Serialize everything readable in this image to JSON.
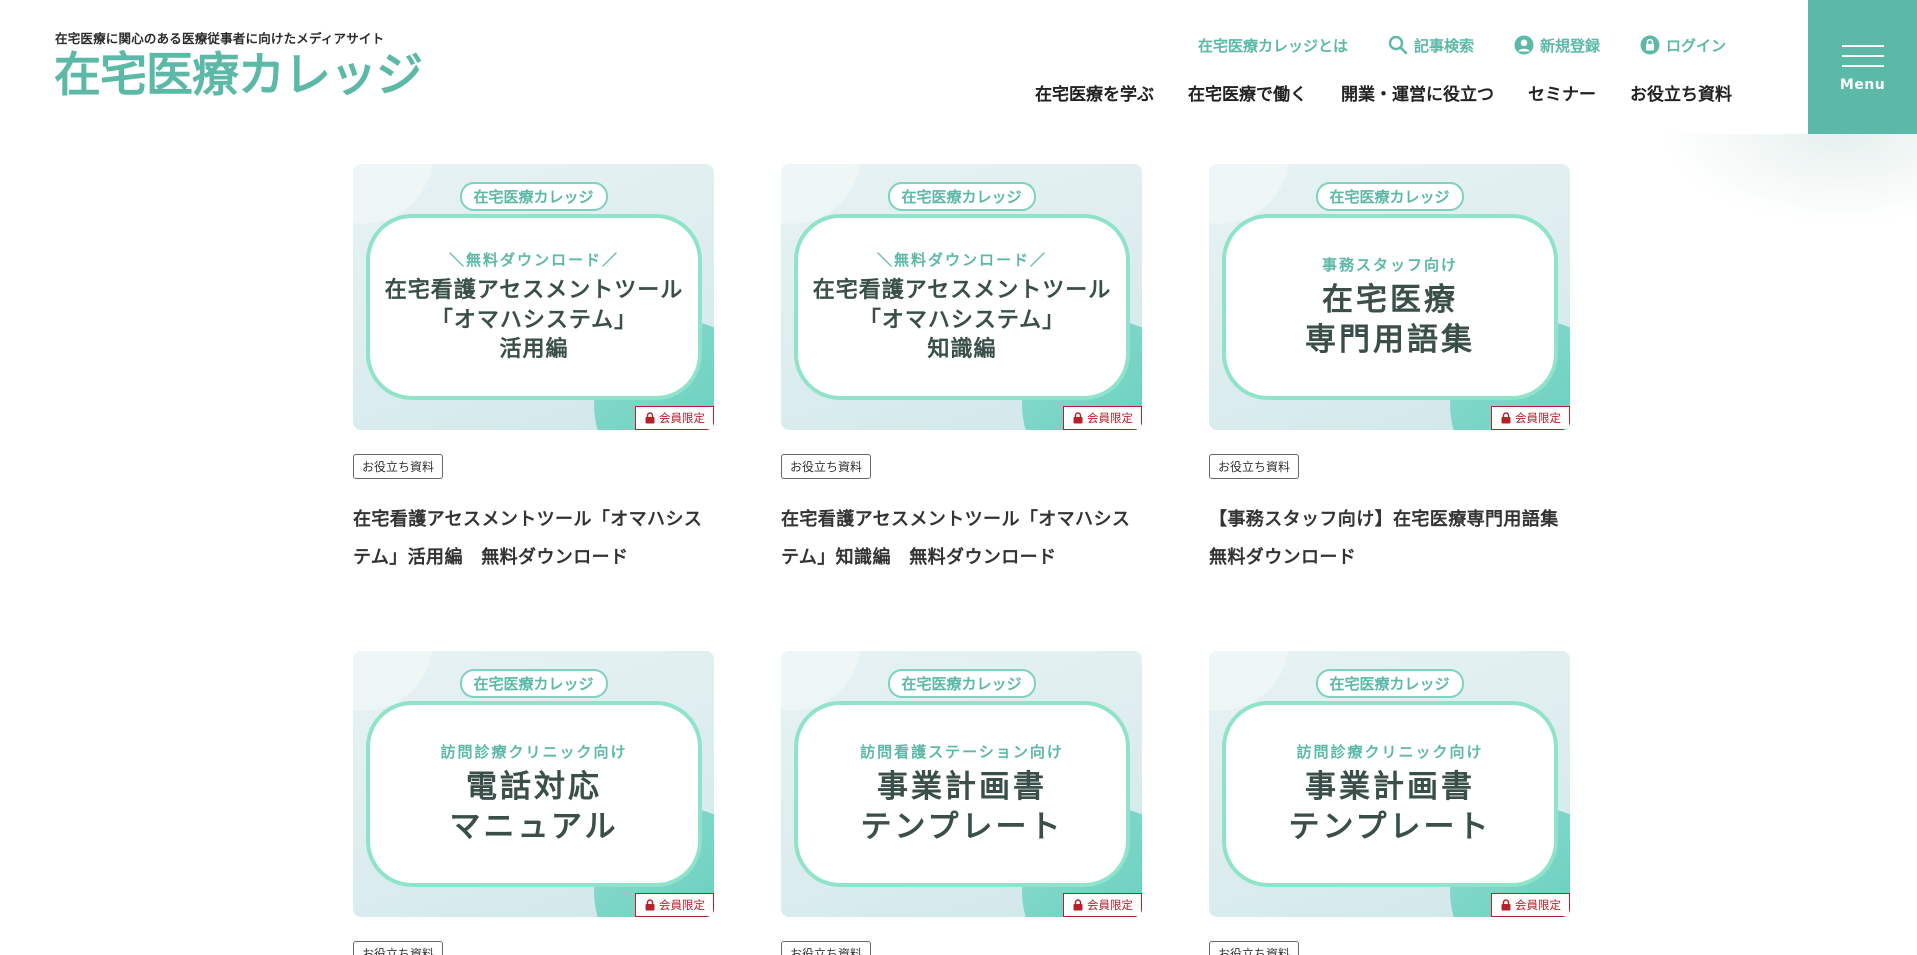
{
  "header": {
    "tagline": "在宅医療に関心のある医療従事者に向けたメディアサイト",
    "logo": "在宅医療カレッジ",
    "util_nav": [
      {
        "label": "在宅医療カレッジとは",
        "icon": null
      },
      {
        "label": "記事検索",
        "icon": "search-icon"
      },
      {
        "label": "新規登録",
        "icon": "user-icon"
      },
      {
        "label": "ログイン",
        "icon": "lock-icon"
      }
    ],
    "main_nav": [
      "在宅医療を学ぶ",
      "在宅医療で働く",
      "開業・運営に役立つ",
      "セミナー",
      "お役立ち資料"
    ],
    "menu_label": "Menu"
  },
  "colors": {
    "accent": "#5cb9a8",
    "lock_badge": "#b4232a"
  },
  "cards": [
    {
      "thumb_tag": "在宅医療カレッジ",
      "thumb_sub": "＼無料ダウンロード／",
      "thumb_main": "在宅看護アセスメントツール\n「オマハシステム」\n活用編",
      "badge": "会員限定",
      "category": "お役立ち資料",
      "title": "在宅看護アセスメントツール「オマハシステム」活用編　無料ダウンロード"
    },
    {
      "thumb_tag": "在宅医療カレッジ",
      "thumb_sub": "＼無料ダウンロード／",
      "thumb_main": "在宅看護アセスメントツール\n「オマハシステム」\n知識編",
      "badge": "会員限定",
      "category": "お役立ち資料",
      "title": "在宅看護アセスメントツール「オマハシステム」知識編　無料ダウンロード"
    },
    {
      "thumb_tag": "在宅医療カレッジ",
      "thumb_sub": "事務スタッフ向け",
      "thumb_main": "在宅医療\n専門用語集",
      "badge": "会員限定",
      "category": "お役立ち資料",
      "title": "【事務スタッフ向け】在宅医療専門用語集　無料ダウンロード"
    },
    {
      "thumb_tag": "在宅医療カレッジ",
      "thumb_sub": "訪問診療クリニック向け",
      "thumb_main": "電話対応\nマニュアル",
      "badge": "会員限定",
      "category": "お役立ち資料",
      "title": ""
    },
    {
      "thumb_tag": "在宅医療カレッジ",
      "thumb_sub": "訪問看護ステーション向け",
      "thumb_main": "事業計画書\nテンプレート",
      "badge": "会員限定",
      "category": "お役立ち資料",
      "title": ""
    },
    {
      "thumb_tag": "在宅医療カレッジ",
      "thumb_sub": "訪問診療クリニック向け",
      "thumb_main": "事業計画書\nテンプレート",
      "badge": "会員限定",
      "category": "お役立ち資料",
      "title": ""
    }
  ]
}
